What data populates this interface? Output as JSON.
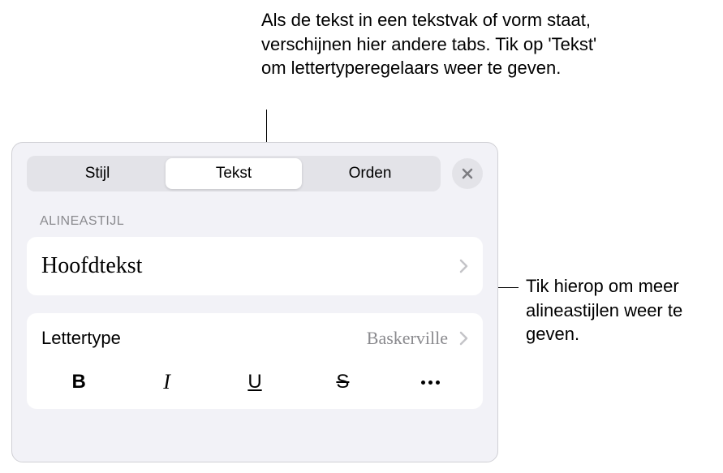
{
  "callouts": {
    "top": "Als de tekst in een tekstvak of vorm staat, verschijnen hier andere tabs. Tik op 'Tekst' om lettertyperegelaars weer te geven.",
    "right": "Tik hierop om meer alineastijlen weer te geven."
  },
  "tabs": {
    "style": "Stijl",
    "text": "Tekst",
    "arrange": "Orden"
  },
  "sections": {
    "paragraph": {
      "label": "ALINEASTIJL",
      "value": "Hoofdtekst"
    },
    "font": {
      "label": "Lettertype",
      "value": "Baskerville"
    },
    "styleButtons": {
      "bold": "B",
      "italic": "I",
      "underline": "U",
      "strike": "S"
    }
  }
}
